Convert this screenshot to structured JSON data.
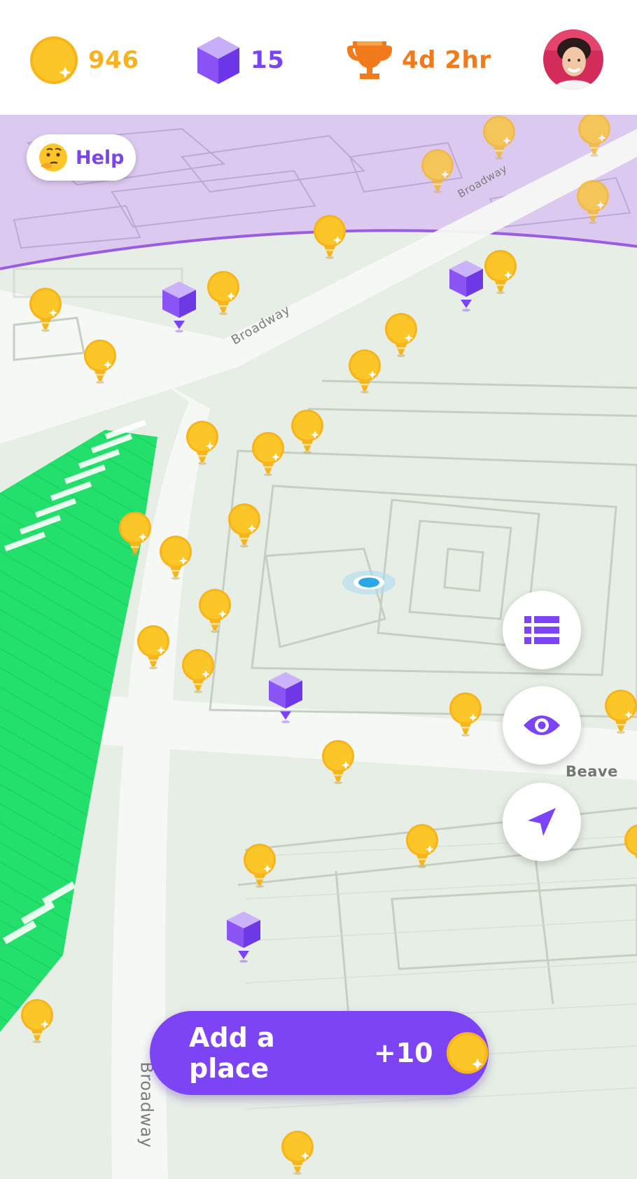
{
  "header": {
    "coins": "946",
    "gems": "15",
    "timer": "4d 2hr",
    "colors": {
      "coins": "#f7b21e",
      "gems": "#7a45f0",
      "timer": "#f07a1c"
    }
  },
  "map": {
    "help_label": "Help",
    "streets": {
      "broadway_top": "Broadway",
      "broadway_mid": "Broadway",
      "broadway_bottom": "Broadway",
      "beaver": "Beave"
    },
    "colors": {
      "zone": "#dcc9f2",
      "zone_border": "#9a5de0",
      "park": "#22e06b",
      "pin": "#fbbf24",
      "crystal": "#8b55f5"
    }
  },
  "controls": {
    "list_icon": "list-icon",
    "eye_icon": "eye-icon",
    "locate_icon": "navigation-arrow-icon"
  },
  "add_place": {
    "label": "Add a place",
    "reward": "+10"
  }
}
